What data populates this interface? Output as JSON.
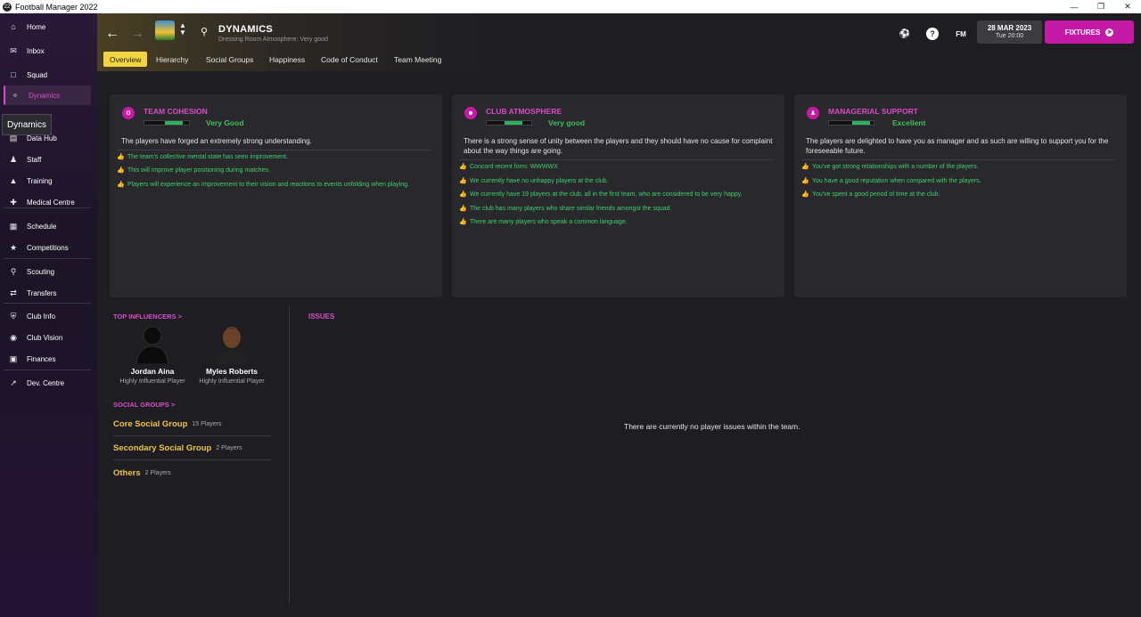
{
  "window": {
    "title": "Football Manager 2022",
    "icon": "22"
  },
  "sidebar": {
    "tooltip": "Dynamics",
    "items": [
      {
        "label": "Home",
        "icon": "home-icon"
      },
      {
        "label": "Inbox",
        "icon": "inbox-icon"
      },
      {
        "label": "Squad",
        "icon": "shirt-icon"
      },
      {
        "label": "Dynamics",
        "icon": "dynamics-icon",
        "active": true
      },
      {
        "label": "Data Hub",
        "icon": "chart-icon"
      },
      {
        "label": "Staff",
        "icon": "staff-icon"
      },
      {
        "label": "Training",
        "icon": "training-icon"
      },
      {
        "label": "Medical Centre",
        "icon": "medical-icon"
      },
      {
        "label": "Schedule",
        "icon": "calendar-icon"
      },
      {
        "label": "Competitions",
        "icon": "trophy-icon"
      },
      {
        "label": "Scouting",
        "icon": "scouting-icon"
      },
      {
        "label": "Transfers",
        "icon": "transfers-icon"
      },
      {
        "label": "Club Info",
        "icon": "shield-icon"
      },
      {
        "label": "Club Vision",
        "icon": "vision-icon"
      },
      {
        "label": "Finances",
        "icon": "finances-icon"
      },
      {
        "label": "Dev. Centre",
        "icon": "dev-centre-icon"
      }
    ]
  },
  "header": {
    "title": "DYNAMICS",
    "subtitle": "Dressing Room Atmosphere: Very good",
    "date": "28 MAR 2023",
    "time": "Tue 20:00",
    "fixtures_label": "FIXTURES",
    "fm_label": "FM",
    "help_label": "?"
  },
  "tabs": [
    {
      "label": "Overview",
      "active": true
    },
    {
      "label": "Hierarchy"
    },
    {
      "label": "Social Groups"
    },
    {
      "label": "Happiness"
    },
    {
      "label": "Code of Conduct"
    },
    {
      "label": "Team Meeting"
    }
  ],
  "panels": [
    {
      "title": "TEAM COHESION",
      "level": "Very Good",
      "meter": 0.85,
      "description": "The players have forged an extremely strong understanding.",
      "points": [
        "The team's collective mental state has seen improvement.",
        "This will improve player positioning during matches.",
        "Players will experience an improvement to their vision and reactions to events unfolding when playing."
      ]
    },
    {
      "title": "CLUB ATMOSPHERE",
      "level": "Very good",
      "meter": 0.8,
      "description": "There is a strong sense of unity between the players and they should have no cause for complaint about the way things are going.",
      "points": [
        "Concord recent form: WWWWX",
        "We currently have no unhappy players at the club.",
        "We currently have 19 players at the club, all in the first team, who are considered to be very happy.",
        "The club has many players who share similar friends amongst the squad.",
        "There are many players who speak a common language."
      ]
    },
    {
      "title": "MANAGERIAL SUPPORT",
      "level": "Excellent",
      "meter": 0.92,
      "description": "The players are delighted to have you as manager and as such are willing to support you for the foreseeable future.",
      "points": [
        "You've got strong relationships with a number of the players.",
        "You have a good reputation when compared with the players.",
        "You've spent a good period of time at the club."
      ]
    }
  ],
  "influencers": {
    "title": "TOP INFLUENCERS >",
    "players": [
      {
        "name": "Jordan Aina",
        "role": "Highly Influential Player"
      },
      {
        "name": "Myles Roberts",
        "role": "Highly Influential Player"
      }
    ]
  },
  "social_groups": {
    "title": "SOCIAL GROUPS >",
    "groups": [
      {
        "name": "Core Social Group",
        "count": "15 Players"
      },
      {
        "name": "Secondary Social Group",
        "count": "2 Players"
      },
      {
        "name": "Others",
        "count": "2 Players"
      }
    ]
  },
  "issues": {
    "title": "ISSUES",
    "message": "There are currently no player issues within the team."
  }
}
